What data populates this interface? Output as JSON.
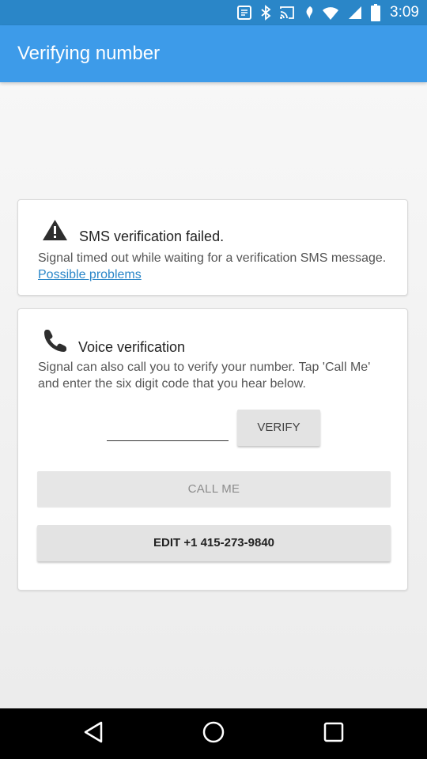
{
  "status_bar": {
    "time": "3:09",
    "icons": [
      "notification-icon",
      "bluetooth-icon",
      "cast-icon",
      "nfc-icon",
      "wifi-icon",
      "signal-icon",
      "battery-icon"
    ]
  },
  "app_bar": {
    "title": "Verifying number",
    "color": "#3d9be9"
  },
  "sms_card": {
    "icon": "warning-icon",
    "title": "SMS verification failed.",
    "body": "Signal timed out while waiting for a verification SMS message.",
    "link": "Possible problems"
  },
  "voice_card": {
    "icon": "phone-icon",
    "title": "Voice verification",
    "body": "Signal can also call you to verify your number. Tap 'Call Me' and enter the six digit code that you hear below.",
    "code_input_value": "",
    "verify_label": "VERIFY",
    "call_me_label": "CALL ME",
    "edit_label": "EDIT +1 415-273-9840"
  },
  "nav_bar": {
    "icons": [
      "back-icon",
      "home-icon",
      "recents-icon"
    ]
  },
  "colors": {
    "accent": "#3d9be9",
    "status_bar": "#2a86c8",
    "link": "#2a86c8"
  }
}
